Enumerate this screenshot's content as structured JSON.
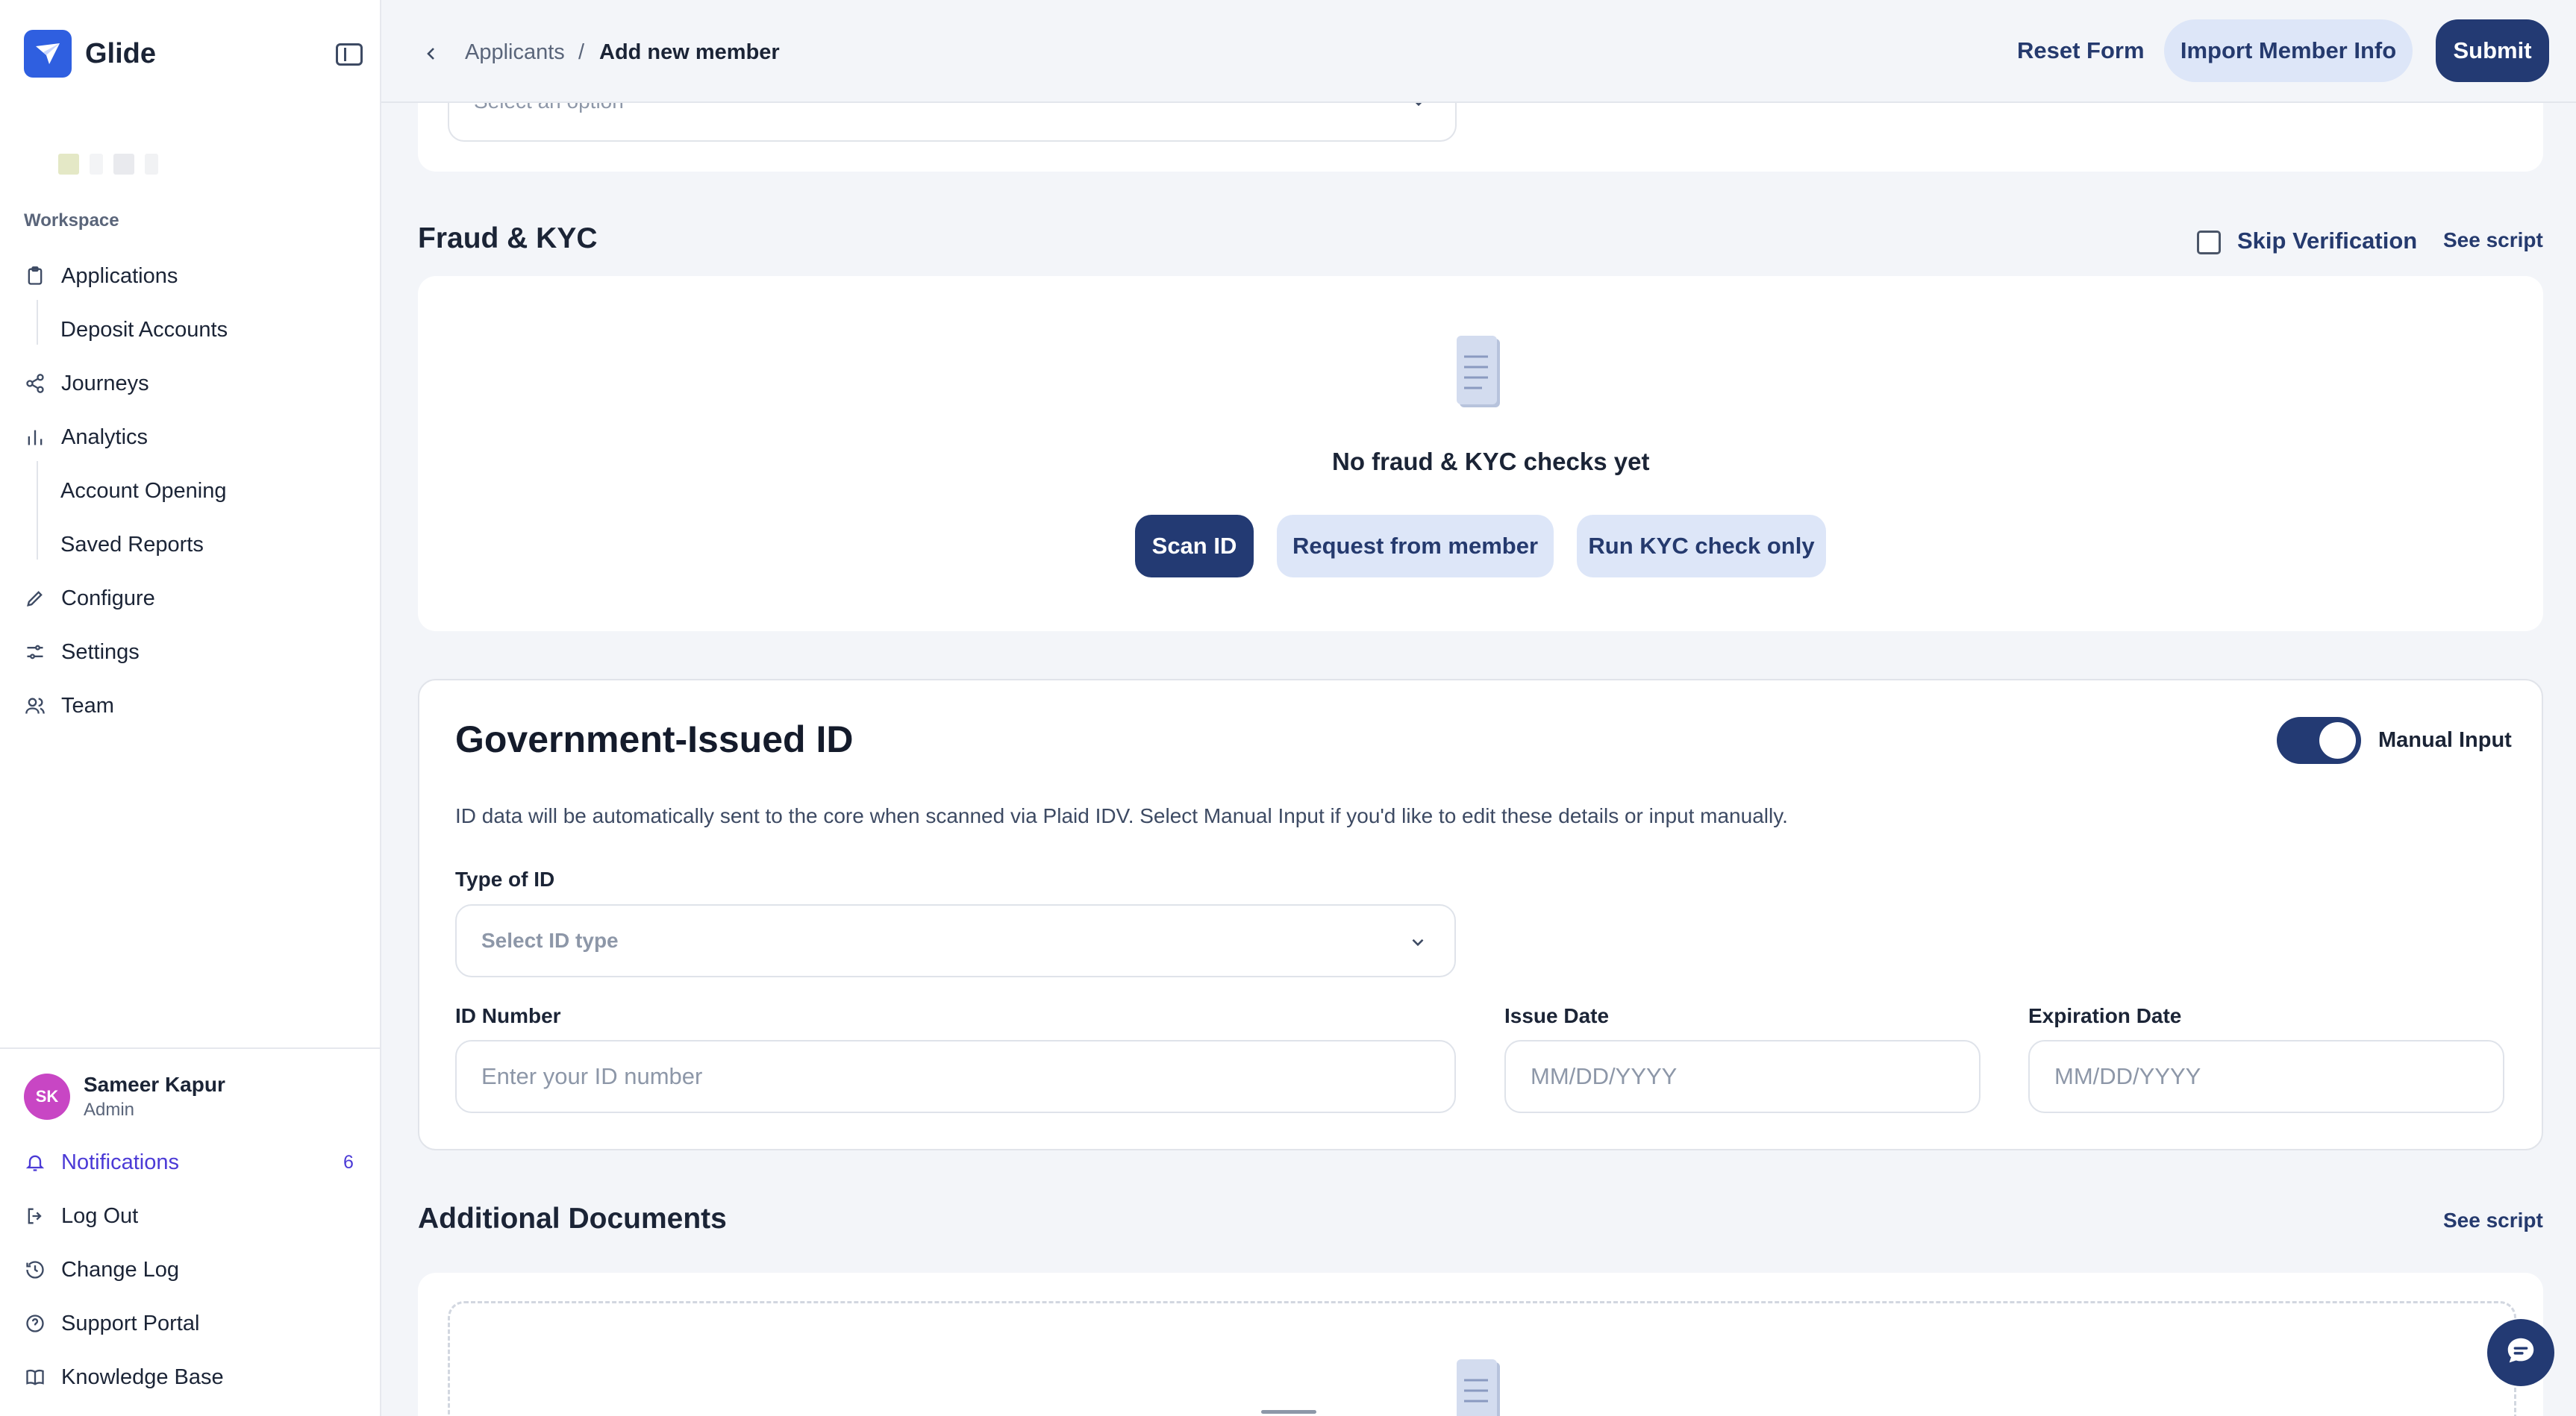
{
  "brand": {
    "name": "Glide"
  },
  "sidebar": {
    "section_label": "Workspace",
    "items": [
      {
        "label": "Applications",
        "icon": "clipboard-icon"
      },
      {
        "label": "Deposit Accounts"
      },
      {
        "label": "Journeys",
        "icon": "share-nodes-icon"
      },
      {
        "label": "Analytics",
        "icon": "bar-chart-icon"
      },
      {
        "label": "Account Opening"
      },
      {
        "label": "Saved Reports"
      },
      {
        "label": "Configure",
        "icon": "pencil-icon"
      },
      {
        "label": "Settings",
        "icon": "sliders-icon"
      },
      {
        "label": "Team",
        "icon": "users-icon"
      }
    ],
    "user": {
      "initials": "SK",
      "name": "Sameer Kapur",
      "role": "Admin"
    },
    "bottom": [
      {
        "label": "Notifications",
        "badge": "6",
        "icon": "bell-icon"
      },
      {
        "label": "Log Out",
        "icon": "logout-icon"
      },
      {
        "label": "Change Log",
        "icon": "history-icon"
      },
      {
        "label": "Support Portal",
        "icon": "help-circle-icon"
      },
      {
        "label": "Knowledge Base",
        "icon": "book-icon"
      }
    ]
  },
  "header": {
    "breadcrumb_parent": "Applicants",
    "breadcrumb_sep": "/",
    "breadcrumb_current": "Add new member",
    "reset_label": "Reset Form",
    "import_label": "Import Member Info",
    "submit_label": "Submit"
  },
  "top_select": {
    "placeholder": "Select an option"
  },
  "fraud_kyc": {
    "title": "Fraud & KYC",
    "skip_label": "Skip Verification",
    "see_script": "See script",
    "empty_text": "No fraud & KYC checks yet",
    "scan_label": "Scan ID",
    "request_label": "Request from member",
    "run_label": "Run KYC check only"
  },
  "gov_id": {
    "title": "Government-Issued ID",
    "toggle_label": "Manual Input",
    "toggle_on": true,
    "helper": "ID data will be automatically sent to the core when scanned via Plaid IDV. Select Manual Input if you'd like to edit these details or input manually.",
    "type_label": "Type of ID",
    "type_placeholder": "Select ID type",
    "number_label": "ID Number",
    "number_placeholder": "Enter your ID number",
    "issue_label": "Issue Date",
    "issue_placeholder": "MM/DD/YYYY",
    "expiration_label": "Expiration Date",
    "expiration_placeholder": "MM/DD/YYYY"
  },
  "additional_docs": {
    "title": "Additional Documents",
    "see_script": "See script"
  },
  "colors": {
    "primary": "#233a73",
    "soft": "#dde6f8",
    "brand": "#2f5fe0",
    "notification": "#4b3ad6",
    "avatar": "#c846c4"
  }
}
